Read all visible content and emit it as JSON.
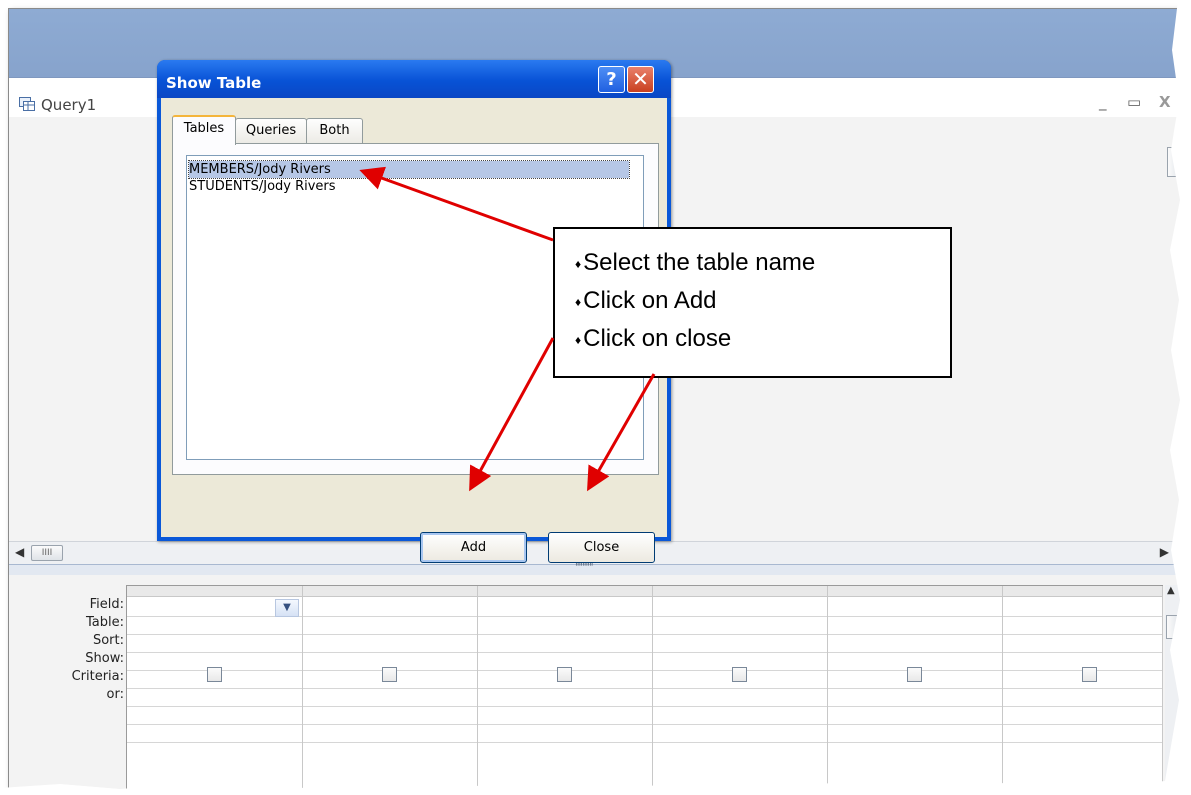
{
  "app": {
    "query_title": "Query1",
    "window_controls": {
      "minimize": "_",
      "restore": "▭",
      "close": "X"
    }
  },
  "dialog": {
    "title": "Show Table",
    "help_label": "?",
    "close_label": "✕",
    "tabs": [
      {
        "label": "Tables",
        "active": true
      },
      {
        "label": "Queries",
        "active": false
      },
      {
        "label": "Both",
        "active": false
      }
    ],
    "tables": [
      {
        "label": "MEMBERS/Jody Rivers",
        "selected": true
      },
      {
        "label": "STUDENTS/Jody Rivers",
        "selected": false
      }
    ],
    "add_label": "Add",
    "close_button_label": "Close"
  },
  "callout": {
    "bullet": "♦",
    "lines": [
      "Select the table name",
      "Click on Add",
      "Click on close"
    ]
  },
  "grid": {
    "row_labels": [
      "Field:",
      "Table:",
      "Sort:",
      "Show:",
      "Criteria:",
      "or:"
    ],
    "scroll_thumb": "IIII",
    "splitter": "''''''''''",
    "columns": 6
  },
  "colors": {
    "dialog_title": "#0a58d8",
    "annotation_arrow": "#e00000",
    "title_bar": "#8eabd3"
  },
  "icons": {
    "query": "query-table-icon",
    "help": "help-icon",
    "close": "close-icon",
    "dropdown": "chevron-down-icon"
  }
}
